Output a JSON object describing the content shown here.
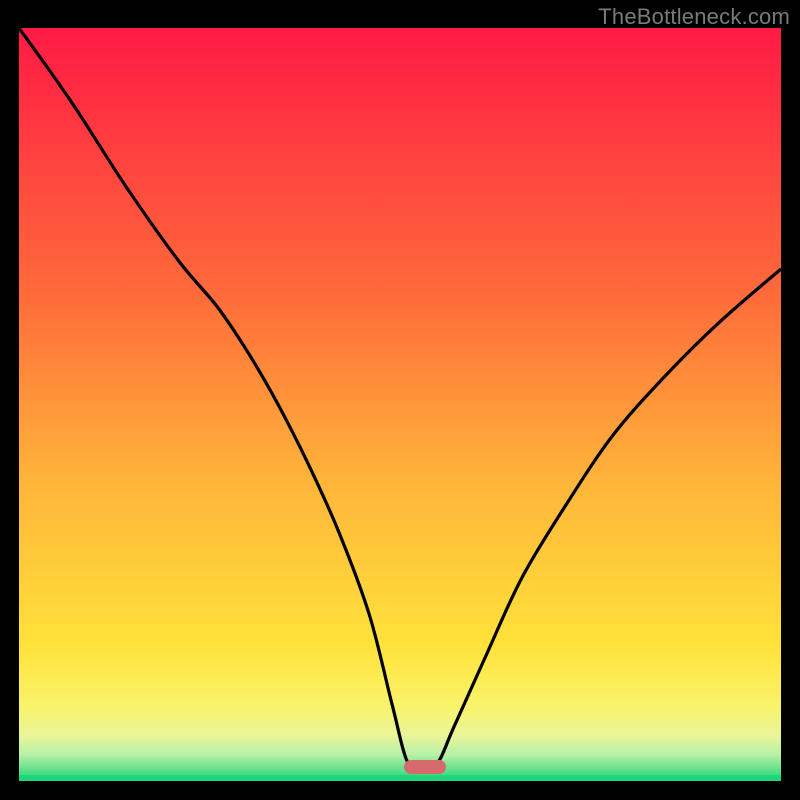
{
  "watermark": "TheBottleneck.com",
  "gradient": {
    "c0": "#ff1a44",
    "c1": "#ff6a3a",
    "c2": "#ffb43a",
    "c3": "#ffe23a",
    "c4": "#faf36a",
    "c5": "#e9f59a",
    "c6": "#b8f0a6",
    "c7": "#1fd67a"
  },
  "marker": {
    "color": "#d66a6a",
    "left_pct": 50.5,
    "width_pct": 5.6,
    "bottom_pct": 0.9
  },
  "chart_data": {
    "type": "line",
    "title": "",
    "xlabel": "",
    "ylabel": "",
    "xlim": [
      0,
      100
    ],
    "ylim": [
      0,
      100
    ],
    "series": [
      {
        "name": "bottleneck-curve",
        "x": [
          0,
          7,
          14,
          21,
          26,
          30,
          34,
          38,
          42,
          46,
          49,
          51,
          53,
          55,
          57,
          61,
          66,
          72,
          78,
          85,
          92,
          100
        ],
        "y": [
          100,
          90,
          79,
          69,
          63,
          57,
          50,
          42,
          33,
          22,
          10,
          2.5,
          1.5,
          2.5,
          7,
          16,
          27,
          37,
          46,
          54,
          61,
          68
        ]
      }
    ],
    "optimal_marker_x": [
      50.5,
      56.1
    ]
  }
}
